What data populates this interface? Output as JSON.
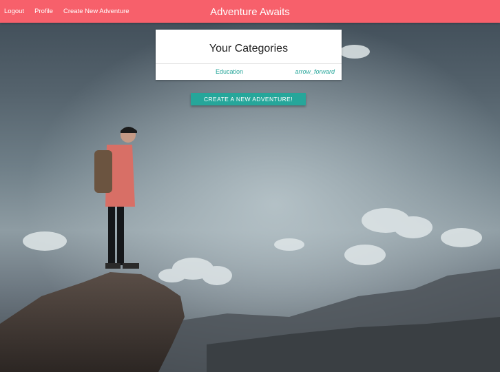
{
  "navbar": {
    "links": [
      "Logout",
      "Profile",
      "Create New Adventure"
    ],
    "brand": "Adventure Awaits",
    "color": "#f7606b"
  },
  "categories_card": {
    "title": "Your Categories",
    "items": [
      {
        "label": "Education",
        "action_icon": "arrow_forward"
      }
    ]
  },
  "create_button": {
    "label": "CREATE A NEW ADVENTURE!",
    "color": "#26a69a"
  },
  "background": {
    "description_icon": "hiker-on-cliff-image"
  }
}
